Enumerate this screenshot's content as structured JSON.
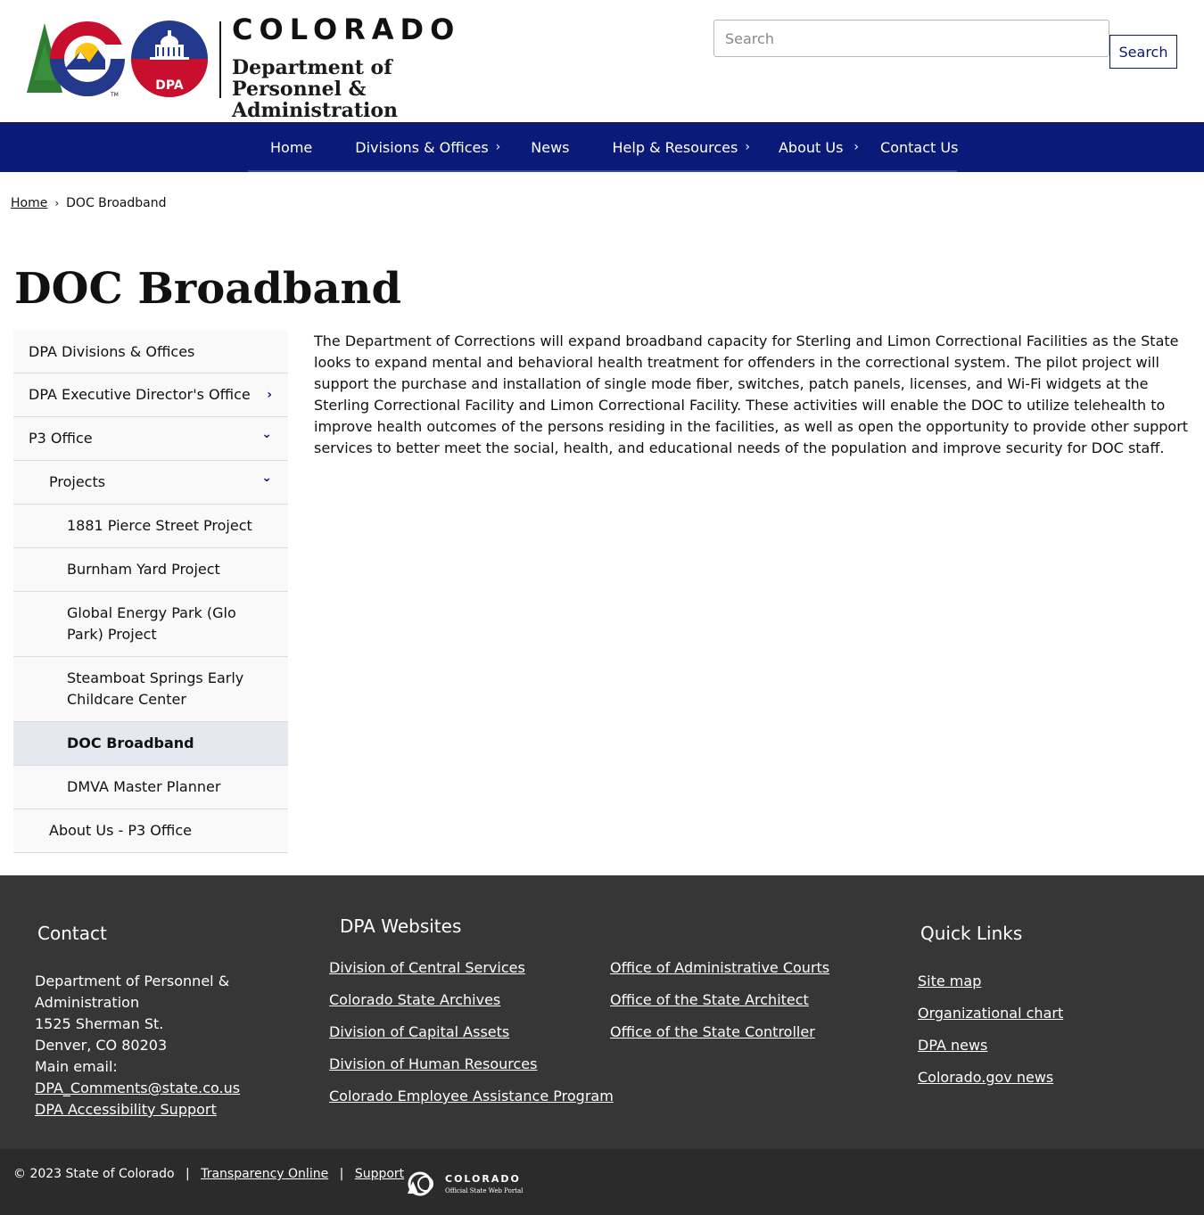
{
  "header": {
    "logo_state": "COLORADO",
    "logo_dept": "Department of Personnel & Administration",
    "logo_badge": "DPA",
    "search_placeholder": "Search",
    "search_button": "Search"
  },
  "nav": {
    "items": [
      {
        "label": "Home",
        "has_children": false
      },
      {
        "label": "Divisions & Offices",
        "has_children": true
      },
      {
        "label": "News",
        "has_children": false
      },
      {
        "label": "Help & Resources",
        "has_children": true
      },
      {
        "label": "About Us",
        "has_children": true
      },
      {
        "label": "Contact Us",
        "has_children": false
      }
    ],
    "chevron": "›"
  },
  "breadcrumb": {
    "home": "Home",
    "separator": "›",
    "current": "DOC Broadband"
  },
  "page_title": "DOC Broadband",
  "sidenav": {
    "items": [
      {
        "label": "DPA Divisions & Offices",
        "arrow": ""
      },
      {
        "label": "DPA Executive Director's Office",
        "arrow": "›"
      },
      {
        "label": "P3 Office",
        "arrow": "⌄"
      },
      {
        "label": "Projects",
        "arrow": "⌄"
      },
      {
        "label": "1881 Pierce Street Project",
        "arrow": ""
      },
      {
        "label": "Burnham Yard Project",
        "arrow": ""
      },
      {
        "label": "Global Energy Park (Glo Park) Project",
        "arrow": ""
      },
      {
        "label": "Steamboat Springs Early Childcare Center",
        "arrow": ""
      },
      {
        "label": "DOC Broadband",
        "arrow": ""
      },
      {
        "label": "DMVA Master Planner",
        "arrow": ""
      },
      {
        "label": "About Us - P3 Office",
        "arrow": ""
      }
    ]
  },
  "main": {
    "body": "The Department of Corrections will expand broadband capacity for Sterling and Limon Correctional Facilities as the State looks to expand mental and behavioral health treatment for offenders in the correctional system. The pilot project will support the purchase and installation of single mode fiber, switches, patch panels, licenses, and Wi-Fi widgets at the Sterling Correctional Facility and Limon Correctional Facility. These activities will enable the DOC to utilize telehealth to improve health outcomes of the persons residing in the facilities, as well as open the opportunity to provide other support services to better meet the social, health, and educational needs of the population and improve security for DOC staff."
  },
  "footer": {
    "contact_heading": "Contact",
    "contact_name": "Department of Personnel & Administration",
    "contact_street": "1525 Sherman St.",
    "contact_city": "Denver, CO 80203",
    "contact_email_label": "Main email:",
    "contact_email": "DPA_Comments@state.co.us",
    "contact_accessibility": "DPA Accessibility Support",
    "websites_heading": "DPA Websites",
    "websites_col1": [
      "Division of Central Services",
      "Colorado State Archives",
      "Division of Capital Assets",
      "Division of Human Resources",
      "Colorado Employee Assistance Program"
    ],
    "websites_col2": [
      "Office of Administrative Courts",
      "Office of the State Architect",
      "Office of the State Controller"
    ],
    "quicklinks_heading": "Quick Links",
    "quicklinks": [
      "Site map",
      "Organizational chart",
      "DPA news",
      "Colorado.gov news"
    ]
  },
  "bottom": {
    "copyright": "© 2023 State of Colorado",
    "separator": "|",
    "transparency": "Transparency Online",
    "support": "Support",
    "portal_name": "COLORADO",
    "portal_sub": "Official State Web Portal"
  },
  "colors": {
    "nav_bg": "#0a1a78",
    "footer_bg": "#363636",
    "bottombar_bg": "#2b2b2b",
    "logo_red": "#c8102e",
    "logo_blue": "#233a8c",
    "logo_green": "#2e7d32",
    "logo_yellow": "#ffc20e"
  },
  "icons": {
    "search": "search-icon",
    "chevron": "chevron-right-icon",
    "chevron_down": "chevron-down-icon"
  }
}
